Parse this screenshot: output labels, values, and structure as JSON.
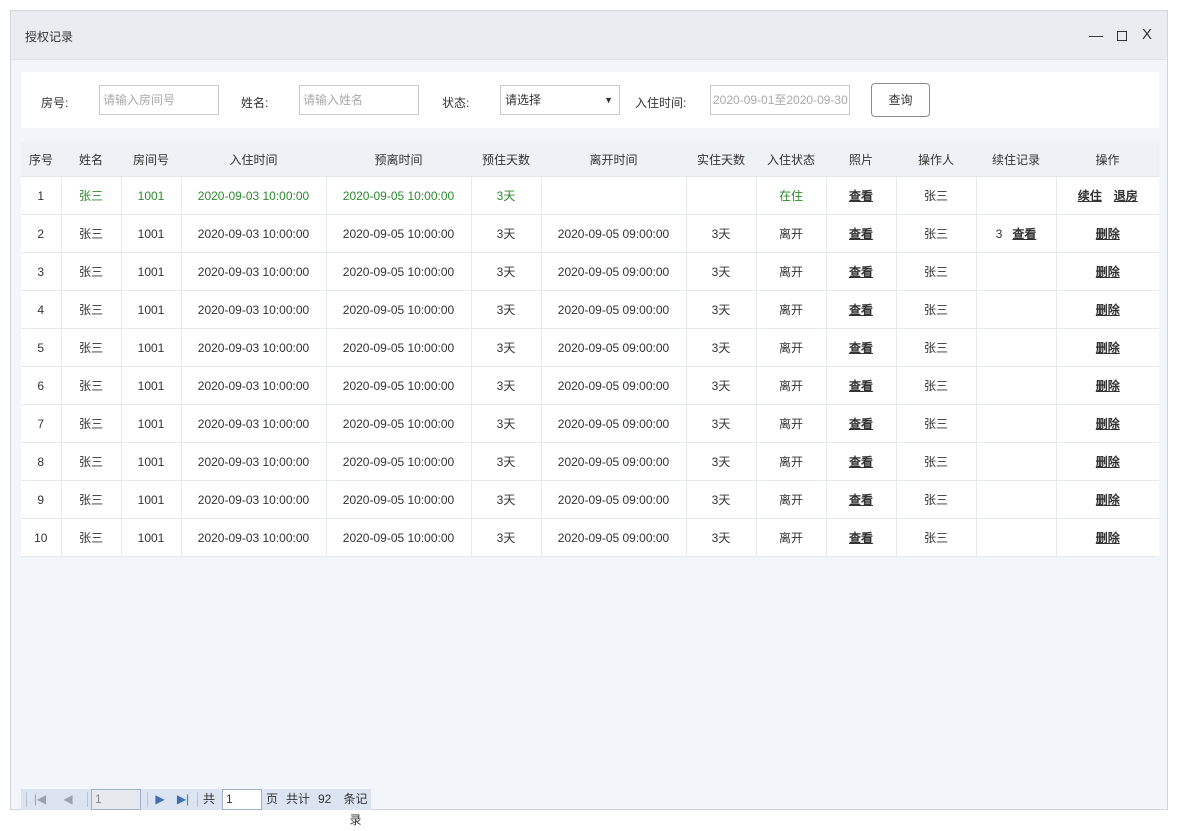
{
  "window": {
    "title": "授权记录",
    "min_icon": "minimize-icon",
    "max_icon": "maximize-icon",
    "close_label": "X"
  },
  "filters": {
    "room_label": "房号:",
    "room_placeholder": "请输入房间号",
    "name_label": "姓名:",
    "name_placeholder": "请输入姓名",
    "status_label": "状态:",
    "status_value": "请选择",
    "checkin_label": "入住时间:",
    "date_range": "2020-09-01至2020-09-30",
    "query_label": "查询"
  },
  "table": {
    "headers": [
      "序号",
      "姓名",
      "房间号",
      "入住时间",
      "预离时间",
      "预住天数",
      "离开时间",
      "实住天数",
      "入住状态",
      "照片",
      "操作人",
      "续住记录",
      "操作"
    ],
    "rows": [
      {
        "no": "1",
        "name": "张三",
        "room": "1001",
        "checkin": "2020-09-03 10:00:00",
        "expected_leave": "2020-09-05 10:00:00",
        "expected_days": "3天",
        "leave": "",
        "actual_days": "",
        "status": "在住",
        "photo": "查看",
        "operator": "张三",
        "renew_count": "",
        "renew_link": "",
        "actions": [
          "续住",
          "退房"
        ]
      },
      {
        "no": "2",
        "name": "张三",
        "room": "1001",
        "checkin": "2020-09-03 10:00:00",
        "expected_leave": "2020-09-05 10:00:00",
        "expected_days": "3天",
        "leave": "2020-09-05 09:00:00",
        "actual_days": "3天",
        "status": "离开",
        "photo": "查看",
        "operator": "张三",
        "renew_count": "3",
        "renew_link": "查看",
        "actions": [
          "删除"
        ]
      },
      {
        "no": "3",
        "name": "张三",
        "room": "1001",
        "checkin": "2020-09-03 10:00:00",
        "expected_leave": "2020-09-05 10:00:00",
        "expected_days": "3天",
        "leave": "2020-09-05 09:00:00",
        "actual_days": "3天",
        "status": "离开",
        "photo": "查看",
        "operator": "张三",
        "renew_count": "",
        "renew_link": "",
        "actions": [
          "删除"
        ]
      },
      {
        "no": "4",
        "name": "张三",
        "room": "1001",
        "checkin": "2020-09-03 10:00:00",
        "expected_leave": "2020-09-05 10:00:00",
        "expected_days": "3天",
        "leave": "2020-09-05 09:00:00",
        "actual_days": "3天",
        "status": "离开",
        "photo": "查看",
        "operator": "张三",
        "renew_count": "",
        "renew_link": "",
        "actions": [
          "删除"
        ]
      },
      {
        "no": "5",
        "name": "张三",
        "room": "1001",
        "checkin": "2020-09-03 10:00:00",
        "expected_leave": "2020-09-05 10:00:00",
        "expected_days": "3天",
        "leave": "2020-09-05 09:00:00",
        "actual_days": "3天",
        "status": "离开",
        "photo": "查看",
        "operator": "张三",
        "renew_count": "",
        "renew_link": "",
        "actions": [
          "删除"
        ]
      },
      {
        "no": "6",
        "name": "张三",
        "room": "1001",
        "checkin": "2020-09-03 10:00:00",
        "expected_leave": "2020-09-05 10:00:00",
        "expected_days": "3天",
        "leave": "2020-09-05 09:00:00",
        "actual_days": "3天",
        "status": "离开",
        "photo": "查看",
        "operator": "张三",
        "renew_count": "",
        "renew_link": "",
        "actions": [
          "删除"
        ]
      },
      {
        "no": "7",
        "name": "张三",
        "room": "1001",
        "checkin": "2020-09-03 10:00:00",
        "expected_leave": "2020-09-05 10:00:00",
        "expected_days": "3天",
        "leave": "2020-09-05 09:00:00",
        "actual_days": "3天",
        "status": "离开",
        "photo": "查看",
        "operator": "张三",
        "renew_count": "",
        "renew_link": "",
        "actions": [
          "删除"
        ]
      },
      {
        "no": "8",
        "name": "张三",
        "room": "1001",
        "checkin": "2020-09-03 10:00:00",
        "expected_leave": "2020-09-05 10:00:00",
        "expected_days": "3天",
        "leave": "2020-09-05 09:00:00",
        "actual_days": "3天",
        "status": "离开",
        "photo": "查看",
        "operator": "张三",
        "renew_count": "",
        "renew_link": "",
        "actions": [
          "删除"
        ]
      },
      {
        "no": "9",
        "name": "张三",
        "room": "1001",
        "checkin": "2020-09-03 10:00:00",
        "expected_leave": "2020-09-05 10:00:00",
        "expected_days": "3天",
        "leave": "2020-09-05 09:00:00",
        "actual_days": "3天",
        "status": "离开",
        "photo": "查看",
        "operator": "张三",
        "renew_count": "",
        "renew_link": "",
        "actions": [
          "删除"
        ]
      },
      {
        "no": "10",
        "name": "张三",
        "room": "1001",
        "checkin": "2020-09-03 10:00:00",
        "expected_leave": "2020-09-05 10:00:00",
        "expected_days": "3天",
        "leave": "2020-09-05 09:00:00",
        "actual_days": "3天",
        "status": "离开",
        "photo": "查看",
        "operator": "张三",
        "renew_count": "",
        "renew_link": "",
        "actions": [
          "删除"
        ]
      }
    ]
  },
  "pager": {
    "current_page": "1",
    "total_prefix": "共",
    "total_pages": "1",
    "page_suffix": "页",
    "records_prefix": "共计",
    "records_count": "92",
    "records_suffix": "条记录",
    "first_icon": "first-page-icon",
    "prev_icon": "prev-page-icon",
    "next_icon": "next-page-icon",
    "last_icon": "last-page-icon"
  },
  "colors": {
    "active_row_text": "#2c8a2c",
    "header_bg": "#eef1f5",
    "page_bg": "#f2f6fa",
    "pager_bg": "#dbe4f0"
  }
}
